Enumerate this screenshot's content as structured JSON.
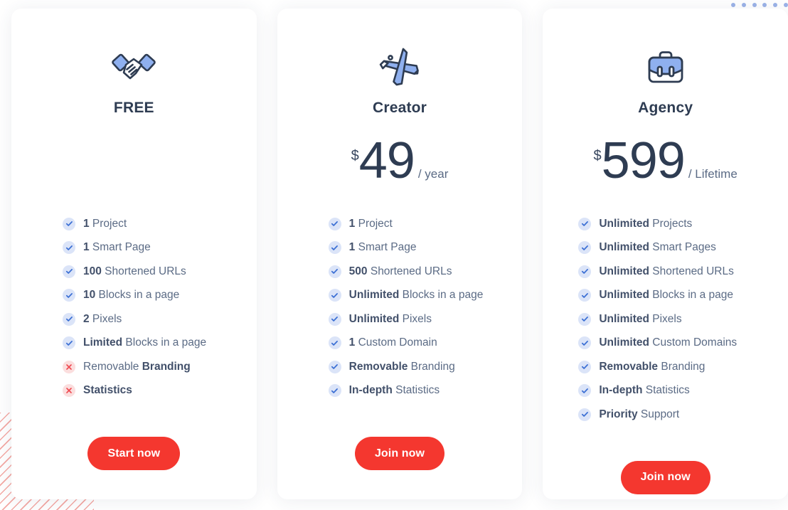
{
  "decor": {
    "dot_count": 6,
    "dot_color": "#7b9ae0",
    "stripe_color": "#f4a9a4"
  },
  "theme": {
    "accent_red": "#f4372f",
    "icon_blue": "#8fb0ef",
    "icon_outline": "#2e3c52",
    "check_bg": "#dbe4f8",
    "check_mark": "#3b6fd4",
    "cross_bg": "#fbdede",
    "cross_mark": "#ef4b52",
    "title_color": "#2e3c52",
    "text_color": "#5b6b85"
  },
  "plans": [
    {
      "id": "free",
      "icon": "handshake-icon",
      "title": "FREE",
      "price": {
        "currency": "",
        "amount": "",
        "period": ""
      },
      "features": [
        {
          "status": "yes",
          "strong": "1",
          "rest": " Project"
        },
        {
          "status": "yes",
          "strong": "1",
          "rest": " Smart Page"
        },
        {
          "status": "yes",
          "strong": "100",
          "rest": " Shortened URLs"
        },
        {
          "status": "yes",
          "strong": "10",
          "rest": " Blocks in a page"
        },
        {
          "status": "yes",
          "strong": "2",
          "rest": " Pixels"
        },
        {
          "status": "yes",
          "strong": "Limited",
          "rest": " Blocks in a page"
        },
        {
          "status": "no",
          "leading": "Removable ",
          "strong": "Branding",
          "rest": ""
        },
        {
          "status": "no",
          "strong": "Statistics",
          "rest": ""
        }
      ],
      "cta": "Start now"
    },
    {
      "id": "creator",
      "icon": "pencil-pen-icon",
      "title": "Creator",
      "price": {
        "currency": "$",
        "amount": "49",
        "period": "/ year"
      },
      "features": [
        {
          "status": "yes",
          "strong": "1",
          "rest": " Project"
        },
        {
          "status": "yes",
          "strong": "1",
          "rest": " Smart Page"
        },
        {
          "status": "yes",
          "strong": "500",
          "rest": " Shortened URLs"
        },
        {
          "status": "yes",
          "strong": "Unlimited",
          "rest": " Blocks in a page"
        },
        {
          "status": "yes",
          "strong": "Unlimited",
          "rest": " Pixels"
        },
        {
          "status": "yes",
          "strong": "1",
          "rest": " Custom Domain"
        },
        {
          "status": "yes",
          "strong": "Removable",
          "rest": " Branding"
        },
        {
          "status": "yes",
          "strong": "In-depth",
          "rest": " Statistics"
        }
      ],
      "cta": "Join now"
    },
    {
      "id": "agency",
      "icon": "briefcase-icon",
      "title": "Agency",
      "price": {
        "currency": "$",
        "amount": "599",
        "period": "/ Lifetime"
      },
      "features": [
        {
          "status": "yes",
          "strong": "Unlimited",
          "rest": " Projects"
        },
        {
          "status": "yes",
          "strong": "Unlimited",
          "rest": " Smart Pages"
        },
        {
          "status": "yes",
          "strong": "Unlimited",
          "rest": " Shortened URLs"
        },
        {
          "status": "yes",
          "strong": "Unlimited",
          "rest": " Blocks in a page"
        },
        {
          "status": "yes",
          "strong": "Unlimited",
          "rest": " Pixels"
        },
        {
          "status": "yes",
          "strong": "Unlimited",
          "rest": " Custom Domains"
        },
        {
          "status": "yes",
          "strong": "Removable",
          "rest": " Branding"
        },
        {
          "status": "yes",
          "strong": "In-depth",
          "rest": " Statistics"
        },
        {
          "status": "yes",
          "strong": "Priority",
          "rest": " Support"
        }
      ],
      "cta": "Join now"
    }
  ]
}
